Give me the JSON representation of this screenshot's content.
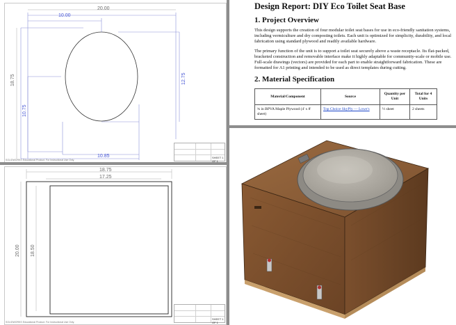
{
  "drawing_top": {
    "dimensions": {
      "overall_width": "20.00",
      "half_width": "10.00",
      "overall_height": "18.75",
      "oval_height": "12.75",
      "lower_height": "10.75",
      "bottom_width": "10.85"
    },
    "watermark": "SOLIDWORKS Educational Product. For Instructional Use Only.",
    "scale_text": "SHEET 1 OF 1"
  },
  "drawing_bottom": {
    "dimensions": {
      "outer_width": "18.75",
      "inner_width": "17.25",
      "outer_height": "20.00",
      "inner_height": "18.50"
    },
    "watermark": "SOLIDWORKS Educational Product. For Instructional Use Only.",
    "scale_text": "SHEET 1 OF 1"
  },
  "report": {
    "title": "Design Report: DIY Eco Toilet Seat Base",
    "section1_heading": "1. Project Overview",
    "para1": "This design supports the creation of four modular toilet seat bases for use in eco-friendly sanitation systems, including vermiculture and dry composting toilets. Each unit is optimized for simplicity, durability, and local fabrication using standard plywood and readily available hardware.",
    "para2": "The primary function of the unit is to support a toilet seat securely above a waste receptacle. Its flat-packed, bracketed construction and removable interface make it highly adaptable for community-scale or mobile use. Full-scale drawings (vectors) are provided for each part to enable straightforward fabrication. These are formatted for A1 printing and intended to be used as direct templates during cutting.",
    "section2_heading": "2. Material Specification",
    "table": {
      "headers": [
        "Material/Component",
        "Source",
        "Quantity per Unit",
        "Total for 4 Units"
      ],
      "rows": [
        [
          "¾ in BPVA Maple Plywood (4' x 8' sheet)",
          "Top Choice SkyPly — Lowe's",
          "½ sheet",
          "2 sheets"
        ]
      ]
    }
  },
  "render": {
    "description_alt": "3D model of plywood toilet seat base"
  },
  "colors": {
    "dimension_blue": "#4a5ad6",
    "wood": "#7a4e2c",
    "background": "#8d8d8d"
  }
}
